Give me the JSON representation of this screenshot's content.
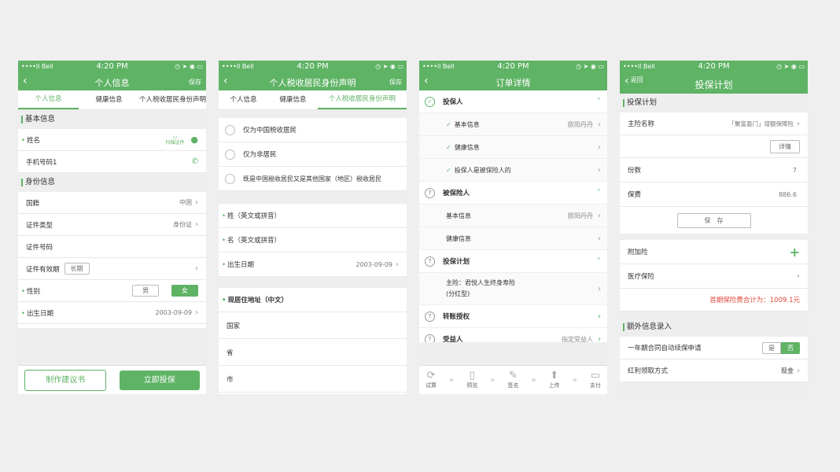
{
  "status": {
    "carrier": "••••ll Bell",
    "time": "4:20 PM",
    "icons": "◷ ➤ ◉ ▭"
  },
  "p1": {
    "title": "个人信息",
    "save": "保存",
    "tabs": [
      "个人信息",
      "健康信息",
      "个人税收居民身份声明"
    ],
    "sec_basic": "基本信息",
    "name": "姓名",
    "scan": "扫描证件",
    "phone": "手机号码1",
    "sec_id": "身份信息",
    "nationality": "国籍",
    "nationality_val": "中国",
    "idtype": "证件类型",
    "idtype_val": "身份证",
    "idno": "证件号码",
    "validity": "证件有效期",
    "longterm": "长期",
    "gender": "性别",
    "male": "男",
    "female": "女",
    "birth": "出生日期",
    "birth_val": "2003-09-09",
    "btn_suggest": "制作建议书",
    "btn_insure": "立即投保"
  },
  "p2": {
    "title": "个人税收居民身份声明",
    "save": "保存",
    "tabs": [
      "个人信息",
      "健康信息",
      "个人税收居民身份声明"
    ],
    "opt1": "仅为中国税收居民",
    "opt2": "仅为非居民",
    "opt3": "既是中国税收居民又是其他国家（地区）税收居民",
    "surname": "姓（英文或拼音）",
    "given": "名（英文或拼音）",
    "birth": "出生日期",
    "birth_val": "2003-09-09",
    "addr": "现居住地址（中文）",
    "country": "国家",
    "province": "省",
    "city": "市"
  },
  "p3": {
    "title": "订单详情",
    "applicant": "投保人",
    "a_basic": "基本信息",
    "a_basic_val": "欧阳丹丹",
    "a_health": "健康信息",
    "a_same": "投保人是被保险人的",
    "insured": "被保险人",
    "i_basic": "基本信息",
    "i_basic_val": "欧阳丹丹",
    "i_health": "健康信息",
    "plan": "投保计划",
    "plan_main": "主险：君悦人生终身寿险",
    "plan_main2": "(分红型)",
    "transfer": "转账授权",
    "beneficiary": "受益人",
    "beneficiary_val": "指定受益人",
    "tools": [
      "试算",
      "预览",
      "签名",
      "上传",
      "支付"
    ]
  },
  "p4": {
    "back": "返回",
    "title": "投保计划",
    "sec_plan": "投保计划",
    "main": "主险名称",
    "main_val": "「聚富盈门」增额保障险",
    "detail": "详情",
    "count": "份数",
    "count_val": "7",
    "premium": "保费",
    "premium_val": "886.6",
    "save": "保　存",
    "addon": "附加险",
    "medical": "医疗保险",
    "total": "首期保险费合计为：1009.1元",
    "sec_extra": "额外信息录入",
    "renew": "一年期合同自动续保申请",
    "yes": "是",
    "no": "否",
    "dividend": "红利领取方式",
    "dividend_val": "现金"
  }
}
